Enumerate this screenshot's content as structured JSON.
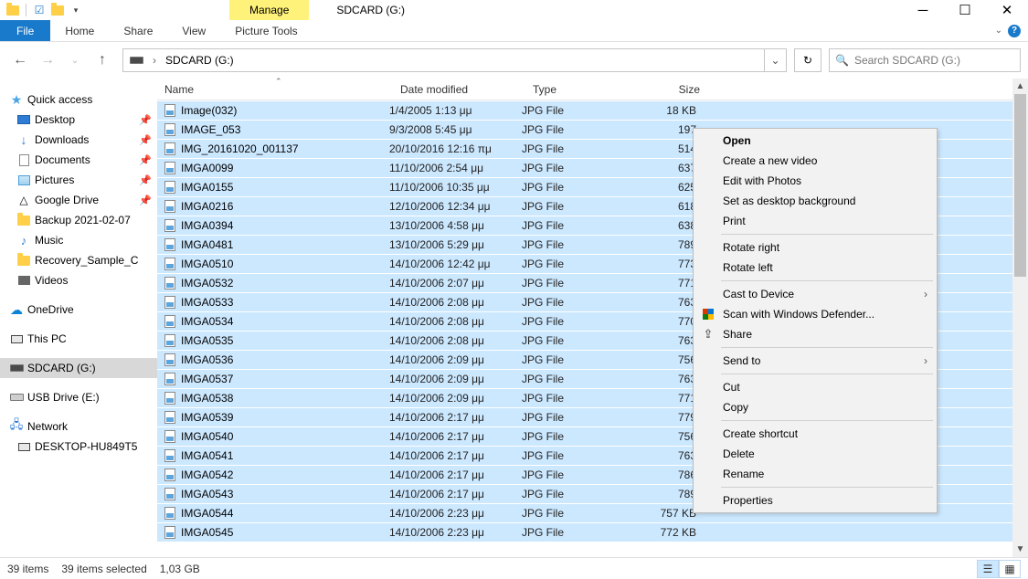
{
  "window": {
    "title": "SDCARD (G:)",
    "manage_tab": "Manage",
    "picture_tools": "Picture Tools"
  },
  "ribbon": {
    "file": "File",
    "home": "Home",
    "share": "Share",
    "view": "View"
  },
  "nav": {
    "breadcrumb": "SDCARD (G:)",
    "search_placeholder": "Search SDCARD (G:)"
  },
  "sidebar": {
    "quick_access": "Quick access",
    "desktop": "Desktop",
    "downloads": "Downloads",
    "documents": "Documents",
    "pictures": "Pictures",
    "google_drive": "Google Drive",
    "backup": "Backup 2021-02-07",
    "music": "Music",
    "recovery": "Recovery_Sample_C",
    "videos": "Videos",
    "onedrive": "OneDrive",
    "this_pc": "This PC",
    "sdcard": "SDCARD (G:)",
    "usb": "USB Drive (E:)",
    "network": "Network",
    "desktop_remote": "DESKTOP-HU849T5"
  },
  "columns": {
    "name": "Name",
    "date": "Date modified",
    "type": "Type",
    "size": "Size"
  },
  "files": [
    {
      "name": "Image(032)",
      "date": "1/4/2005 1:13 μμ",
      "type": "JPG File",
      "size": "18 KB"
    },
    {
      "name": "IMAGE_053",
      "date": "9/3/2008 5:45 μμ",
      "type": "JPG File",
      "size": "197"
    },
    {
      "name": "IMG_20161020_001137",
      "date": "20/10/2016 12:16 πμ",
      "type": "JPG File",
      "size": "514"
    },
    {
      "name": "IMGA0099",
      "date": "11/10/2006 2:54 μμ",
      "type": "JPG File",
      "size": "637"
    },
    {
      "name": "IMGA0155",
      "date": "11/10/2006 10:35 μμ",
      "type": "JPG File",
      "size": "625"
    },
    {
      "name": "IMGA0216",
      "date": "12/10/2006 12:34 μμ",
      "type": "JPG File",
      "size": "618"
    },
    {
      "name": "IMGA0394",
      "date": "13/10/2006 4:58 μμ",
      "type": "JPG File",
      "size": "638"
    },
    {
      "name": "IMGA0481",
      "date": "13/10/2006 5:29 μμ",
      "type": "JPG File",
      "size": "789"
    },
    {
      "name": "IMGA0510",
      "date": "14/10/2006 12:42 μμ",
      "type": "JPG File",
      "size": "773"
    },
    {
      "name": "IMGA0532",
      "date": "14/10/2006 2:07 μμ",
      "type": "JPG File",
      "size": "771"
    },
    {
      "name": "IMGA0533",
      "date": "14/10/2006 2:08 μμ",
      "type": "JPG File",
      "size": "763"
    },
    {
      "name": "IMGA0534",
      "date": "14/10/2006 2:08 μμ",
      "type": "JPG File",
      "size": "770"
    },
    {
      "name": "IMGA0535",
      "date": "14/10/2006 2:08 μμ",
      "type": "JPG File",
      "size": "763"
    },
    {
      "name": "IMGA0536",
      "date": "14/10/2006 2:09 μμ",
      "type": "JPG File",
      "size": "756"
    },
    {
      "name": "IMGA0537",
      "date": "14/10/2006 2:09 μμ",
      "type": "JPG File",
      "size": "763"
    },
    {
      "name": "IMGA0538",
      "date": "14/10/2006 2:09 μμ",
      "type": "JPG File",
      "size": "771"
    },
    {
      "name": "IMGA0539",
      "date": "14/10/2006 2:17 μμ",
      "type": "JPG File",
      "size": "779"
    },
    {
      "name": "IMGA0540",
      "date": "14/10/2006 2:17 μμ",
      "type": "JPG File",
      "size": "756"
    },
    {
      "name": "IMGA0541",
      "date": "14/10/2006 2:17 μμ",
      "type": "JPG File",
      "size": "763"
    },
    {
      "name": "IMGA0542",
      "date": "14/10/2006 2:17 μμ",
      "type": "JPG File",
      "size": "786"
    },
    {
      "name": "IMGA0543",
      "date": "14/10/2006 2:17 μμ",
      "type": "JPG File",
      "size": "789"
    },
    {
      "name": "IMGA0544",
      "date": "14/10/2006 2:23 μμ",
      "type": "JPG File",
      "size": "757 KB"
    },
    {
      "name": "IMGA0545",
      "date": "14/10/2006 2:23 μμ",
      "type": "JPG File",
      "size": "772 KB"
    }
  ],
  "context_menu": {
    "open": "Open",
    "create_video": "Create a new video",
    "edit_photos": "Edit with Photos",
    "set_bg": "Set as desktop background",
    "print": "Print",
    "rotate_right": "Rotate right",
    "rotate_left": "Rotate left",
    "cast": "Cast to Device",
    "defender": "Scan with Windows Defender...",
    "share": "Share",
    "send_to": "Send to",
    "cut": "Cut",
    "copy": "Copy",
    "shortcut": "Create shortcut",
    "delete": "Delete",
    "rename": "Rename",
    "properties": "Properties"
  },
  "status": {
    "count": "39 items",
    "selected": "39 items selected",
    "size": "1,03 GB"
  }
}
